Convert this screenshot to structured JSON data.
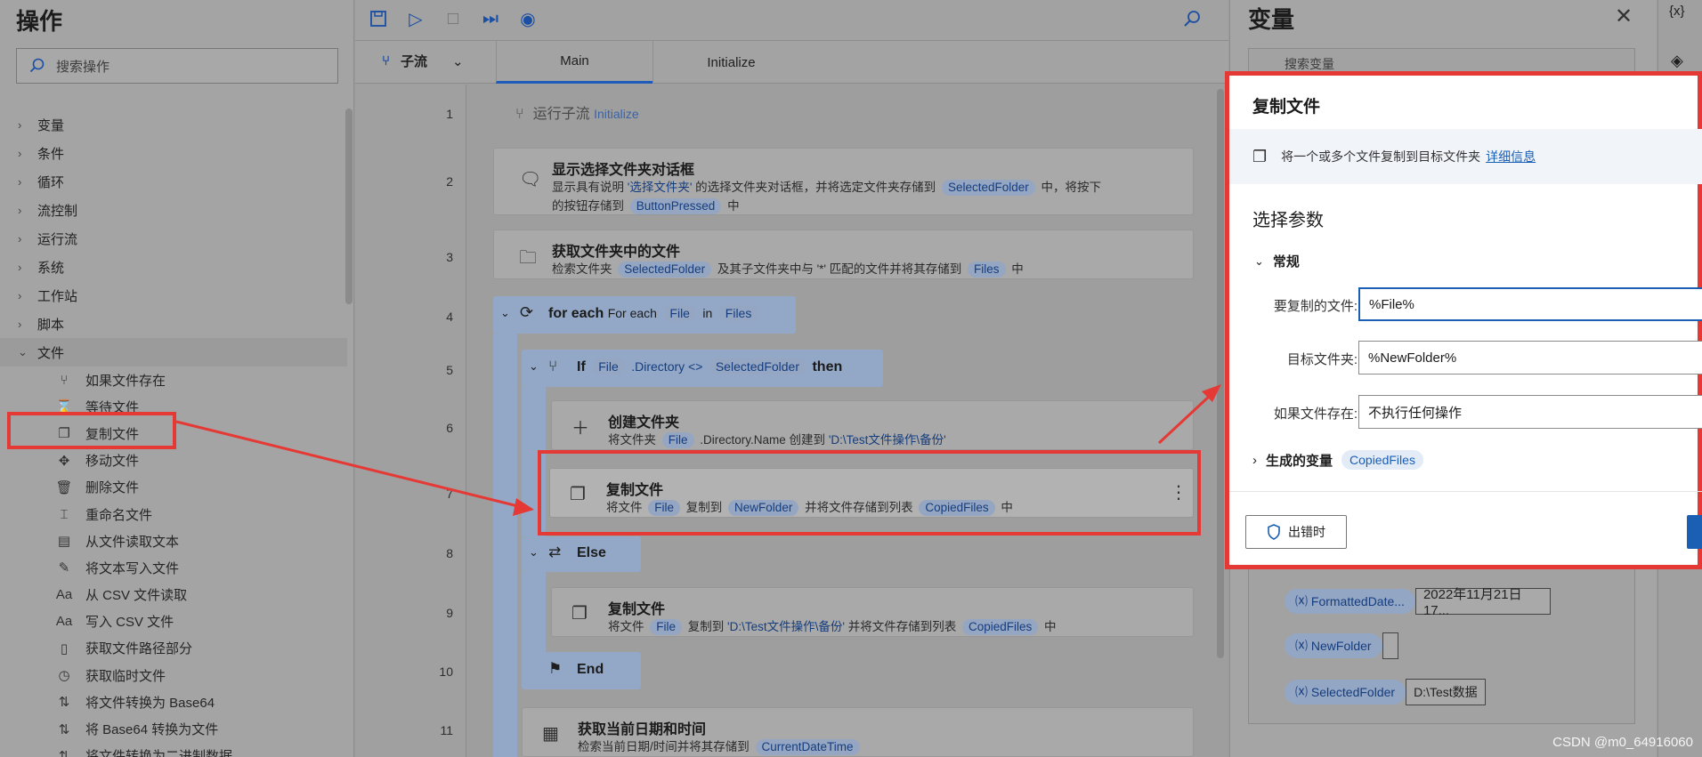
{
  "left_panel": {
    "title": "操作",
    "search_placeholder": "搜索操作",
    "categories": [
      "变量",
      "条件",
      "循环",
      "流控制",
      "运行流",
      "系统",
      "工作站",
      "脚本"
    ],
    "open_category": "文件",
    "file_actions": [
      "如果文件存在",
      "等待文件",
      "复制文件",
      "移动文件",
      "删除文件",
      "重命名文件",
      "从文件读取文本",
      "将文本写入文件",
      "从 CSV 文件读取",
      "写入 CSV 文件",
      "获取文件路径部分",
      "获取临时文件",
      "将文件转换为 Base64",
      "将 Base64 转换为文件",
      "将文件转换为二进制数据"
    ]
  },
  "designer": {
    "subflow_label": "子流",
    "tabs": [
      "Main",
      "Initialize"
    ],
    "line_numbers": [
      "1",
      "2",
      "3",
      "4",
      "5",
      "6",
      "7",
      "8",
      "9",
      "10",
      "11"
    ],
    "run_subflow": {
      "label": "运行子流",
      "target": "Initialize"
    },
    "step2": {
      "title": "显示选择文件夹对话框",
      "d1": "显示具有说明 ",
      "s1": "'选择文件夹'",
      "d2": " 的选择文件夹对话框，并将选定文件夹存储到 ",
      "v1": "SelectedFolder",
      "d3": " 中，将按下",
      "d4": "的按钮存储到 ",
      "v2": "ButtonPressed",
      "d5": " 中"
    },
    "step3": {
      "title": "获取文件夹中的文件",
      "d1": "检索文件夹 ",
      "v1": "SelectedFolder",
      "d2": " 及其子文件夹中与 '*' 匹配的文件并将其存储到 ",
      "v2": "Files",
      "d3": " 中"
    },
    "foreach": {
      "kw": "for each",
      "label": "For each",
      "v1": "File",
      "in": "in",
      "v2": "Files"
    },
    "if": {
      "kw": "If",
      "v1": "File",
      "prop": ".Directory <>",
      "v2": "SelectedFolder",
      "then": "then"
    },
    "step6": {
      "title": "创建文件夹",
      "d1": "将文件夹 ",
      "v1": "File",
      "d2": " .Directory.Name 创建到 ",
      "s1": "'D:\\Test文件操作\\备份'"
    },
    "step7": {
      "title": "复制文件",
      "d1": "将文件 ",
      "v1": "File",
      "d2": " 复制到 ",
      "v2": "NewFolder",
      "d3": " 并将文件存储到列表 ",
      "v3": "CopiedFiles",
      "d4": " 中"
    },
    "else": "Else",
    "step9": {
      "title": "复制文件",
      "d1": "将文件 ",
      "v1": "File",
      "d2": " 复制到 ",
      "s1": "'D:\\Test文件操作\\备份'",
      "d3": " 并将文件存储到列表 ",
      "v2": "CopiedFiles",
      "d4": " 中"
    },
    "end": "End",
    "step11": {
      "title": "获取当前日期和时间",
      "d1": "检索当前日期/时间并将其存储到 ",
      "v1": "CurrentDateTime"
    }
  },
  "variables_panel": {
    "title": "变量",
    "search_placeholder": "搜索变量",
    "rows": [
      {
        "name": "FormattedDate...",
        "value": "2022年11月21日 17..."
      },
      {
        "name": "NewFolder",
        "value": ""
      },
      {
        "name": "SelectedFolder",
        "value": "D:\\Test数据"
      }
    ]
  },
  "right_rail": {
    "label": "{x}"
  },
  "dialog": {
    "title": "复制文件",
    "info": "将一个或多个文件复制到目标文件夹",
    "info_link": "详细信息",
    "section": "选择参数",
    "group": "常规",
    "fields": [
      {
        "label": "要复制的文件:",
        "value": "%File%"
      },
      {
        "label": "目标文件夹:",
        "value": "%NewFolder%"
      },
      {
        "label": "如果文件存在:",
        "value": "不执行任何操作"
      }
    ],
    "generated_label": "生成的变量",
    "generated_var": "CopiedFiles",
    "on_error": "出错时"
  },
  "watermark": "CSDN @m0_64916060",
  "colors": {
    "accent": "#1a5fb4",
    "highlight": "#e53935"
  }
}
